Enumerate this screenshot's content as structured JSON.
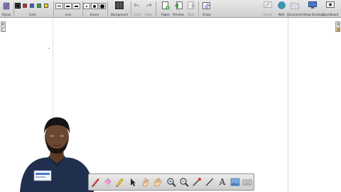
{
  "toolbar": {
    "stylus_label": "Stylus",
    "color_label": "Color",
    "line_label": "Line",
    "eraser_label": "Eraser",
    "background_label": "Background",
    "undo_label": "Undo",
    "redo_label": "Redo",
    "pages_label": "Pages",
    "preview_label": "Preview",
    "next_label": "Next",
    "erase_label": "Erase",
    "board_label": "Board",
    "web_label": "Web",
    "documents_label": "Documents",
    "show_desktop_label": "Show Desktop",
    "openboard_label": "OpenBoard",
    "colors": [
      "#111111",
      "#e21b1b",
      "#2d5fe0",
      "#22a83a",
      "#f2d21b"
    ],
    "active_color": "#111111"
  },
  "icons": {
    "stylus": "pen-tablet-icon",
    "background": "background-grid-icon",
    "undo": "undo-arrow-icon",
    "redo": "redo-arrow-icon",
    "pages": "add-page-icon",
    "preview": "previous-page-icon",
    "next": "next-page-icon",
    "erase": "erase-page-icon",
    "board": "board-icon",
    "web": "globe-icon",
    "documents": "folder-icon",
    "show_desktop": "desktop-icon",
    "openboard": "openboard-menu-icon"
  },
  "side": {
    "left_toggle": "▸",
    "right_toggle": "◂"
  },
  "bottom_tools": [
    "pen-tool-icon",
    "eraser-tool-icon",
    "marker-tool-icon",
    "selector-arrow-icon",
    "interact-hand-icon",
    "hand-pan-icon",
    "zoom-in-icon",
    "zoom-out-icon",
    "laser-pointer-icon",
    "line-tool-icon",
    "text-tool-icon",
    "capture-icon",
    "keyboard-icon"
  ],
  "bottom_text_tool_glyph": "A",
  "colors": {
    "toolbar_bg": "#d9d9d9",
    "canvas_bg": "#ffffff",
    "shirt": "#1f2f4d"
  }
}
